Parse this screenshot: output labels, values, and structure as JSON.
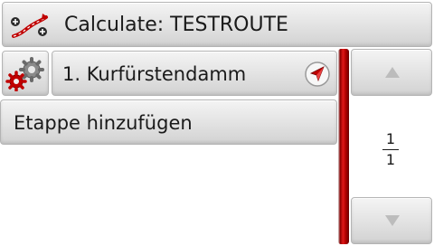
{
  "header": {
    "title": "Calculate: TESTROUTE",
    "icon": "route-calculate-icon"
  },
  "route": {
    "waypoints": [
      {
        "label": "1. Kurfürstendamm",
        "icon": "navigate-arrow-icon"
      }
    ],
    "add_stage_label": "Etappe hinzufügen"
  },
  "settings": {
    "icon": "gears-icon"
  },
  "pager": {
    "current": "1",
    "total": "1",
    "up_icon": "arrow-up-icon",
    "down_icon": "arrow-down-icon"
  },
  "colors": {
    "scrollbar_accent": "#c00000",
    "button_face": "#e4e4e4",
    "text": "#1a1a1a"
  }
}
